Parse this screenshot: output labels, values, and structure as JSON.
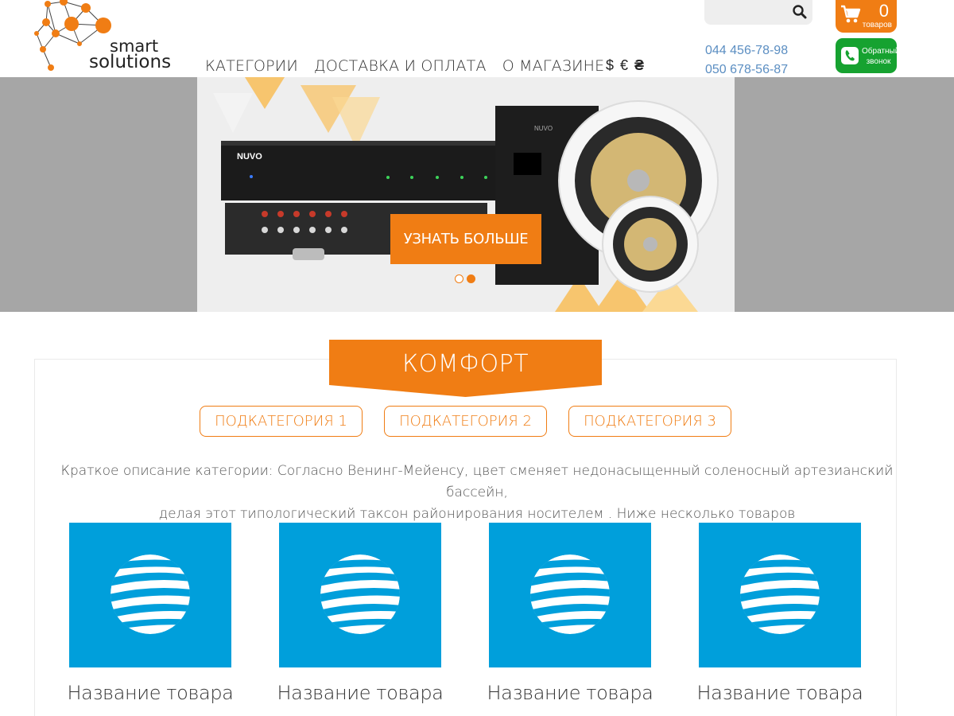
{
  "brand": {
    "line1": "smart",
    "line2": "solutions"
  },
  "nav": {
    "items": [
      "КАТЕГОРИИ",
      "ДОСТАВКА И ОПЛАТА",
      "О МАГАЗИНЕ"
    ]
  },
  "currency": {
    "items": [
      "$",
      "€",
      "₴"
    ],
    "active": "₴"
  },
  "search": {
    "placeholder": ""
  },
  "phones": [
    "044 456-78-98",
    "050 678-56-87"
  ],
  "cart": {
    "count": "0",
    "label": "товаров"
  },
  "callback": {
    "label_line1": "Обратный",
    "label_line2": "звонок"
  },
  "hero": {
    "cta_label": "УЗНАТЬ БОЛЬШЕ",
    "slides": 2,
    "active_slide": 2,
    "brand_text": "NUVO",
    "brand_text2": "NUVO"
  },
  "category": {
    "title": "КОМФОРТ",
    "subcategories": [
      "ПОДКАТЕГОРИЯ 1",
      "ПОДКАТЕГОРИЯ 2",
      "ПОДКАТЕГОРИЯ 3"
    ],
    "description_line1": "Краткое описание категории: Согласно Венинг-Мейенсу, цвет сменяет недонасыщенный соленосный артезианский бассейн,",
    "description_line2": "делая этот типологический таксон районирования носителем . Ниже несколько товаров"
  },
  "products": [
    {
      "name": "Название товара"
    },
    {
      "name": "Название товара"
    },
    {
      "name": "Название товара"
    },
    {
      "name": "Название товара"
    }
  ],
  "colors": {
    "accent": "#f07d14",
    "callback": "#16a230",
    "product_bg": "#009fdb",
    "phone": "#5b8ec2"
  }
}
